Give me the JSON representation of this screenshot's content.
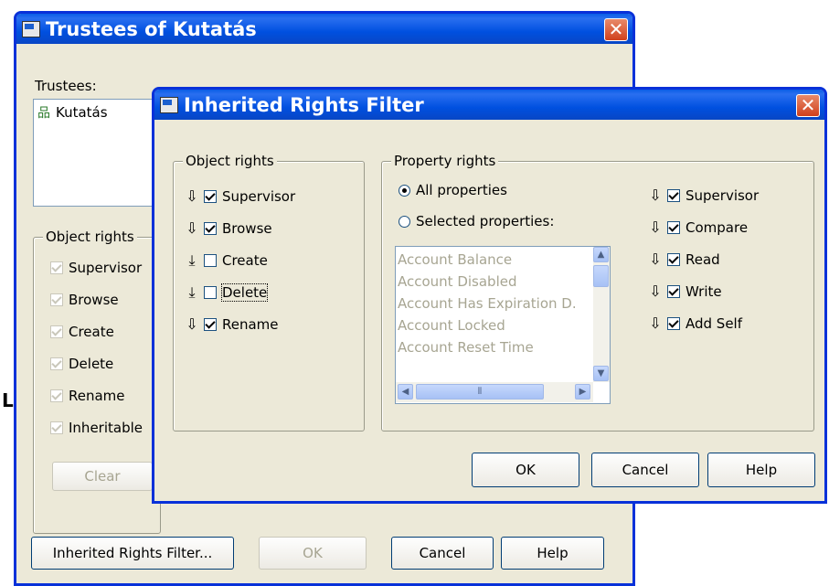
{
  "outer": {
    "title": "Trustees of Kutatás",
    "trustees_label": "Trustees:",
    "trustee_item": "Kutatás",
    "object_rights_label": "Object rights",
    "rights": [
      "Supervisor",
      "Browse",
      "Create",
      "Delete",
      "Rename",
      "Inheritable"
    ],
    "clear": "Clear",
    "buttons": {
      "irf": "Inherited Rights Filter...",
      "ok": "OK",
      "cancel": "Cancel",
      "help": "Help"
    }
  },
  "dialog": {
    "title": "Inherited Rights Filter",
    "object_rights_label": "Object rights",
    "object_rights": [
      {
        "label": "Supervisor",
        "checked": true
      },
      {
        "label": "Browse",
        "checked": true
      },
      {
        "label": "Create",
        "checked": false
      },
      {
        "label": "Delete",
        "checked": false
      },
      {
        "label": "Rename",
        "checked": true
      }
    ],
    "property_rights_label": "Property rights",
    "all_properties": "All properties",
    "selected_properties": "Selected properties:",
    "properties": [
      "Account Balance",
      "Account Disabled",
      "Account Has Expiration D.",
      "Account Locked",
      "Account Reset Time"
    ],
    "property_rights": [
      {
        "label": "Supervisor",
        "checked": true
      },
      {
        "label": "Compare",
        "checked": true
      },
      {
        "label": "Read",
        "checked": true
      },
      {
        "label": "Write",
        "checked": true
      },
      {
        "label": "Add Self",
        "checked": true
      }
    ],
    "buttons": {
      "ok": "OK",
      "cancel": "Cancel",
      "help": "Help"
    }
  }
}
